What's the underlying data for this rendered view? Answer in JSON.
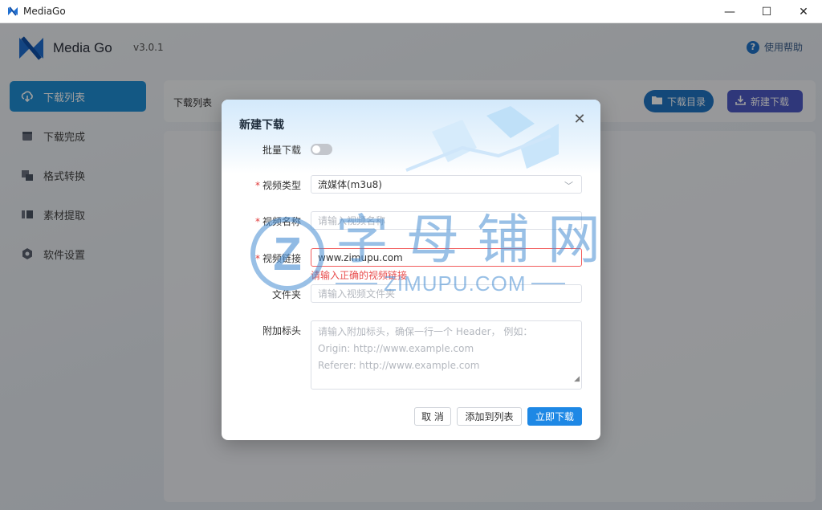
{
  "window": {
    "title": "MediaGo",
    "minimize": "—",
    "maximize": "☐",
    "close": "✕"
  },
  "brand": {
    "name": "Media Go",
    "version": "v3.0.1"
  },
  "header": {
    "help": "使用帮助"
  },
  "sidebar": {
    "items": [
      {
        "label": "下载列表",
        "icon": "cloud-download-icon",
        "active": true
      },
      {
        "label": "下载完成",
        "icon": "box-icon",
        "active": false
      },
      {
        "label": "格式转换",
        "icon": "convert-icon",
        "active": false
      },
      {
        "label": "素材提取",
        "icon": "extract-icon",
        "active": false
      },
      {
        "label": "软件设置",
        "icon": "gear-icon",
        "active": false
      }
    ]
  },
  "main": {
    "breadcrumb": "下载列表",
    "dir_button": "下载目录",
    "new_button": "新建下载"
  },
  "dialog": {
    "title": "新建下载",
    "batch_label": "批量下载",
    "type_label": "视频类型",
    "type_value": "流媒体(m3u8)",
    "name_label": "视频名称",
    "name_placeholder": "请输入视频名称",
    "url_label": "视频链接",
    "url_value": "www.zimupu.com",
    "url_error": "请输入正确的视频链接",
    "folder_label": "文件夹",
    "folder_placeholder": "请输入视频文件夹",
    "headers_label": "附加标头",
    "headers_placeholder_line1": "请输入附加标头，确保一行一个 Header， 例如：",
    "headers_placeholder_line2": "Origin: http://www.example.com",
    "headers_placeholder_line3": "Referer: http://www.example.com",
    "cancel": "取 消",
    "add_to_list": "添加到列表",
    "download_now": "立即下载"
  },
  "watermark": {
    "letter": "Z",
    "cn": "字母铺网",
    "en": "ZIMUPU.COM"
  },
  "colors": {
    "accent": "#1f8fd6",
    "primary_button": "#1e88e5",
    "error": "#e84b4b",
    "new_button": "#4d59c5"
  }
}
